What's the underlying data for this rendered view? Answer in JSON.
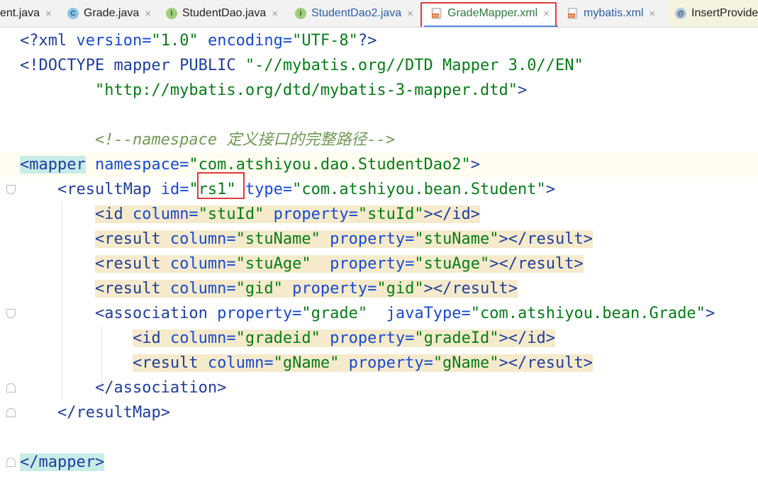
{
  "tabs": [
    {
      "label": "ent.java",
      "icon": "none"
    },
    {
      "label": "Grade.java",
      "icon": "class-icon"
    },
    {
      "label": "StudentDao.java",
      "icon": "interface-icon"
    },
    {
      "label": "StudentDao2.java",
      "icon": "interface-icon"
    },
    {
      "label": "GradeMapper.xml",
      "icon": "xml-file-icon",
      "active": true
    },
    {
      "label": "mybatis.xml",
      "icon": "xml-file-icon"
    },
    {
      "label": "InsertProvide",
      "icon": "annotation-icon"
    }
  ],
  "close_glyph": "×",
  "tab_icon_text": {
    "class": "C",
    "interface": "I",
    "annotation": "@",
    "xml": "<>"
  },
  "code": {
    "l1": {
      "a": "<?",
      "b": "xml",
      "c": " version=",
      "d": "\"1.0\"",
      "e": " encoding=",
      "f": "\"UTF-8\"",
      "g": "?>"
    },
    "l2": {
      "a": "<!DOCTYPE mapper PUBLIC ",
      "b": "\"-//mybatis.org//DTD Mapper 3.0//EN\""
    },
    "l3": {
      "a": "        ",
      "b": "\"http://mybatis.org/dtd/mybatis-3-mapper.dtd\"",
      "c": ">"
    },
    "l4": {
      "a": "        ",
      "b": "<!--namespace 定义接口的完整路径-->"
    },
    "l5": {
      "a": "<mapper",
      "b": " namespace=",
      "c": "\"com.atshiyou.dao.StudentDao2\"",
      "d": ">"
    },
    "l6": {
      "a": "    <",
      "b": "resultMap",
      "c": " id=",
      "d": "\"rs1\"",
      "e": " type=",
      "f": "\"com.atshiyou.bean.Student\"",
      "g": ">"
    },
    "l7": {
      "a": "        ",
      "b": "<id",
      "c": " column=",
      "d": "\"stuId\"",
      "e": " property=",
      "f": "\"stuId\"",
      "g": "></id>"
    },
    "l8": {
      "a": "        ",
      "b": "<result",
      "c": " column=",
      "d": "\"stuName\"",
      "e": " property=",
      "f": "\"stuName\"",
      "g": "></result>"
    },
    "l9": {
      "a": "        ",
      "b": "<result",
      "c": " column=",
      "d": "\"stuAge\"",
      "e": "  property=",
      "f": "\"stuAge\"",
      "g": "></result>"
    },
    "l10": {
      "a": "        ",
      "b": "<result",
      "c": " column=",
      "d": "\"gid\"",
      "e": " property=",
      "f": "\"gid\"",
      "g": "></result>"
    },
    "l11": {
      "a": "        <",
      "b": "association",
      "c": " property=",
      "d": "\"grade\"",
      "e": "  javaType=",
      "f": "\"com.atshiyou.bean.Grade\"",
      "g": ">"
    },
    "l12": {
      "a": "            ",
      "b": "<id",
      "c": " column=",
      "d": "\"gradeid\"",
      "e": " property=",
      "f": "\"gradeId\"",
      "g": "></id>"
    },
    "l13": {
      "a": "            ",
      "b": "<result",
      "c": " column=",
      "d": "\"gName\"",
      "e": " property=",
      "f": "\"gName\"",
      "g": "></result>"
    },
    "l14": {
      "a": "        </",
      "b": "association",
      "c": ">"
    },
    "l15": {
      "a": "    </",
      "b": "resultMap",
      "c": ">"
    },
    "l17": {
      "a": "</mapper>"
    }
  }
}
